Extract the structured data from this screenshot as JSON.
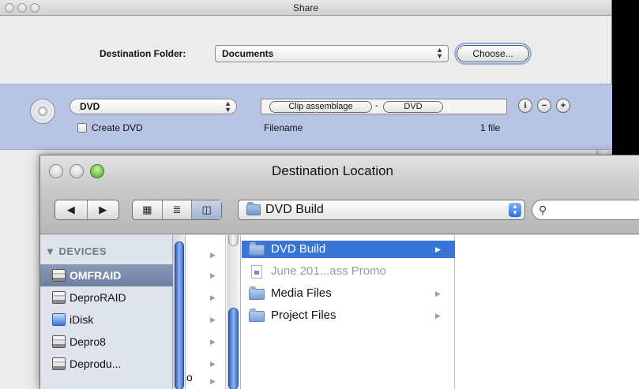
{
  "share": {
    "title": "Share",
    "destination_label": "Destination Folder:",
    "destination_value": "Documents",
    "choose_label": "Choose...",
    "format_value": "DVD",
    "create_dvd_label": "Create DVD",
    "create_dvd_checked": false,
    "filename_tokens": [
      "Clip assemblage",
      "DVD"
    ],
    "filename_separator": "-",
    "filename_label": "Filename",
    "file_count": "1 file",
    "action_buttons": [
      "info-icon",
      "minus-icon",
      "plus-icon"
    ]
  },
  "dest": {
    "title": "Destination Location",
    "current_folder": "DVD Build",
    "search_value": "",
    "sidebar_header": "▼ DEVICES",
    "sidebar_items": [
      {
        "label": "OMFRAID",
        "icon": "drive-icon",
        "selected": true
      },
      {
        "label": "DeproRAID",
        "icon": "drive-icon",
        "selected": false
      },
      {
        "label": "iDisk",
        "icon": "idisk-icon",
        "selected": false
      },
      {
        "label": "Depro8",
        "icon": "drive-icon",
        "selected": false
      },
      {
        "label": "Deprodu...",
        "icon": "drive-icon",
        "selected": false
      }
    ],
    "narrow_column_text": "o",
    "files": [
      {
        "label": "DVD Build",
        "type": "folder",
        "selected": true
      },
      {
        "label": "June 201...ass Promo",
        "type": "document",
        "disabled": true
      },
      {
        "label": "Media Files",
        "type": "folder"
      },
      {
        "label": "Project Files",
        "type": "folder"
      }
    ]
  },
  "glyphs": {
    "back": "◀",
    "forward": "▶",
    "icon_view": "▦",
    "list_view": "≣",
    "column_view": "◫",
    "popup_arrows": "▲▼",
    "search": "🔍",
    "chevron": "▶",
    "info": "i",
    "minus": "−",
    "plus": "+"
  }
}
